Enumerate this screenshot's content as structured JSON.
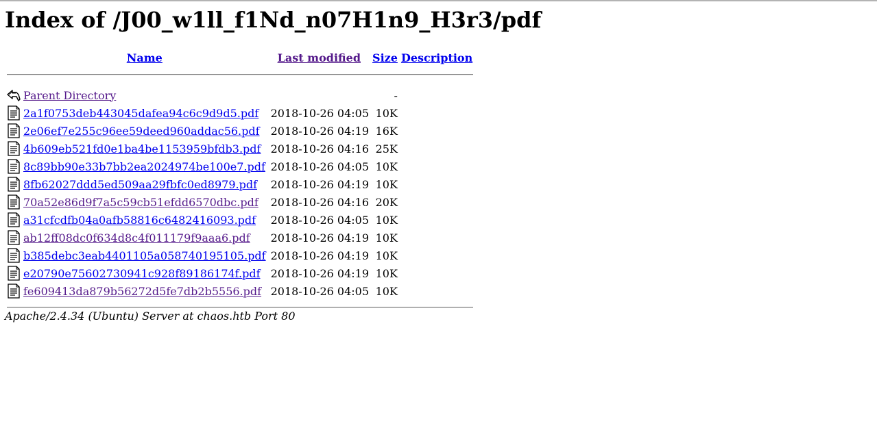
{
  "page": {
    "heading": "Index of /J00_w1ll_f1Nd_n07H1n9_H3r3/pdf"
  },
  "columns": {
    "name": "Name",
    "last_modified": "Last modified",
    "size": "Size",
    "description": "Description"
  },
  "parent": {
    "label": "Parent Directory",
    "size": "-"
  },
  "files": [
    {
      "name": "2a1f0753deb443045dafea94c6c9d9d5.pdf",
      "modified": "2018-10-26 04:05",
      "size": "10K",
      "visited": false
    },
    {
      "name": "2e06ef7e255c96ee59deed960addac56.pdf",
      "modified": "2018-10-26 04:19",
      "size": "16K",
      "visited": false
    },
    {
      "name": "4b609eb521fd0e1ba4be1153959bfdb3.pdf",
      "modified": "2018-10-26 04:16",
      "size": "25K",
      "visited": false
    },
    {
      "name": "8c89bb90e33b7bb2ea2024974be100e7.pdf",
      "modified": "2018-10-26 04:05",
      "size": "10K",
      "visited": false
    },
    {
      "name": "8fb62027ddd5ed509aa29fbfc0ed8979.pdf",
      "modified": "2018-10-26 04:19",
      "size": "10K",
      "visited": false
    },
    {
      "name": "70a52e86d9f7a5c59cb51efdd6570dbc.pdf",
      "modified": "2018-10-26 04:16",
      "size": "20K",
      "visited": true
    },
    {
      "name": "a31cfcdfb04a0afb58816c6482416093.pdf",
      "modified": "2018-10-26 04:05",
      "size": "10K",
      "visited": false
    },
    {
      "name": "ab12ff08dc0f634d8c4f011179f9aaa6.pdf",
      "modified": "2018-10-26 04:19",
      "size": "10K",
      "visited": true
    },
    {
      "name": "b385debc3eab4401105a058740195105.pdf",
      "modified": "2018-10-26 04:19",
      "size": "10K",
      "visited": false
    },
    {
      "name": "e20790e75602730941c928f89186174f.pdf",
      "modified": "2018-10-26 04:19",
      "size": "10K",
      "visited": false
    },
    {
      "name": "fe609413da879b56272d5fe7db2b5556.pdf",
      "modified": "2018-10-26 04:05",
      "size": "10K",
      "visited": true
    }
  ],
  "footer": {
    "signature": "Apache/2.4.34 (Ubuntu) Server at chaos.htb Port 80"
  },
  "icons": {
    "parent": "back-arrow-icon",
    "file": "text-file-icon"
  },
  "colors": {
    "link": "#0000ee",
    "visited_link": "#551a8b"
  }
}
